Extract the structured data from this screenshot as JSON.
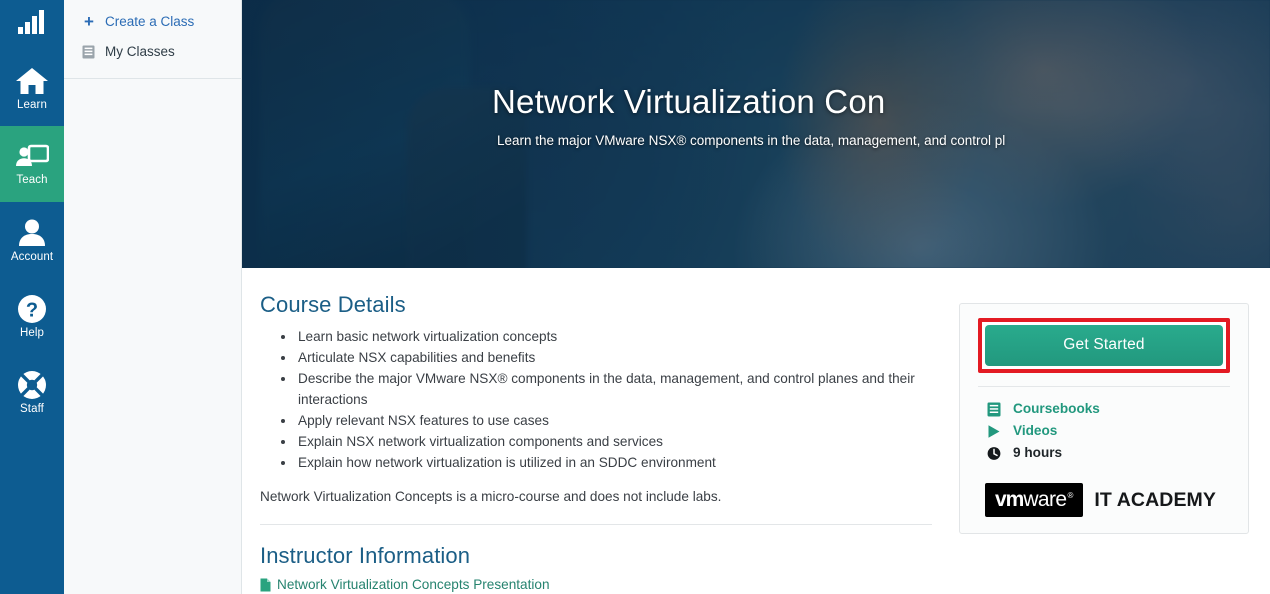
{
  "rail": {
    "items": [
      {
        "label": "",
        "icon": "bar-chart-icon",
        "name": "logo",
        "active": false
      },
      {
        "label": "Learn",
        "icon": "home-icon",
        "name": "learn",
        "active": false
      },
      {
        "label": "Teach",
        "icon": "presentation-icon",
        "name": "teach",
        "active": true
      },
      {
        "label": "Account",
        "icon": "user-icon",
        "name": "account",
        "active": false
      },
      {
        "label": "Help",
        "icon": "question-circle-icon",
        "name": "help",
        "active": false
      },
      {
        "label": "Staff",
        "icon": "lifebuoy-icon",
        "name": "staff",
        "active": false
      }
    ],
    "active_color": "#2aa37f",
    "background": "#0d5c91"
  },
  "subnav": {
    "items": [
      {
        "label": "Create a Class",
        "icon": "plus-icon"
      },
      {
        "label": "My Classes",
        "icon": "book-icon"
      }
    ]
  },
  "hero": {
    "title": "Network Virtualization Con",
    "subtitle": "Learn the major VMware NSX® components in the data, management, and control pl"
  },
  "course_details": {
    "heading": "Course Details",
    "bullets": [
      "Learn basic network virtualization concepts",
      "Articulate NSX capabilities and benefits",
      "Describe the major VMware NSX® components in the data, management, and control planes and their interactions",
      "Apply relevant NSX features to use cases",
      "Explain NSX network virtualization components and services",
      "Explain how network virtualization is utilized in an SDDC environment"
    ],
    "note": "Network Virtualization Concepts is a micro-course and does not include labs."
  },
  "instructor": {
    "heading": "Instructor Information",
    "document_label": "Network Virtualization Concepts Presentation",
    "document_icon": "file-icon"
  },
  "card": {
    "get_started_label": "Get Started",
    "highlight_color": "#e31b23",
    "button_color": "#22987e",
    "meta": [
      {
        "label": "Coursebooks",
        "icon": "book-icon",
        "style": "teal"
      },
      {
        "label": "Videos",
        "icon": "play-icon",
        "style": "teal"
      },
      {
        "label": "9 hours",
        "icon": "clock-icon",
        "style": "dark"
      }
    ],
    "logo": {
      "vm": "vm",
      "ware": "ware",
      "registered": "®",
      "academy": "IT ACADEMY"
    }
  }
}
